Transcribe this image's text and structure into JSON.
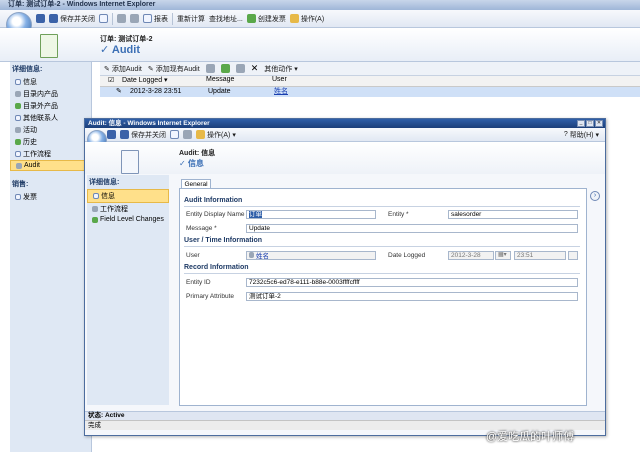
{
  "main_window": {
    "title": "订单: 测试订单-2 - Windows Internet Explorer",
    "toolbar": [
      "保存并关闭",
      "|",
      "报表",
      "重新计算",
      "查找地址...",
      "创建发票",
      "操作(A)"
    ],
    "record_type": "订单: 测试订单-2",
    "record_title": "Audit"
  },
  "left_nav": {
    "header": "详细信息:",
    "items": [
      "信息",
      "目录内产品",
      "目录外产品",
      "其他联系人",
      "活动",
      "历史",
      "工作流程",
      "Audit"
    ],
    "selected": "Audit",
    "sales_header": "销售:",
    "sales_items": [
      "发票"
    ]
  },
  "grid": {
    "toolbar": [
      "添加Audit",
      "添加现有Audit",
      "其他动作"
    ],
    "columns": [
      "Date Logged",
      "Message",
      "User"
    ],
    "rows": [
      {
        "date": "2012-3-28 23:51",
        "message": "Update",
        "user": "姓名"
      }
    ]
  },
  "popup": {
    "title": "Audit: 信息 - Windows Internet Explorer",
    "toolbar": [
      "保存并关闭",
      "操作(A)"
    ],
    "help": "帮助(H)",
    "record_type": "Audit: 信息",
    "record_title": "信息",
    "nav_header": "详细信息:",
    "nav_items": [
      "信息",
      "工作流程",
      "Field Level Changes"
    ],
    "nav_selected": "信息",
    "tab": "General",
    "sections": {
      "audit_info": "Audit Information",
      "user_time": "User / Time Information",
      "record_info": "Record Information"
    },
    "fields": {
      "entity_display_name_label": "Entity Display Name",
      "entity_display_name_value": "订单",
      "entity_label": "Entity *",
      "entity_value": "salesorder",
      "message_label": "Message *",
      "message_value": "Update",
      "user_label": "User",
      "user_value": "姓名",
      "date_logged_label": "Date Logged",
      "date_logged_date": "2012-3-28",
      "date_logged_time": "23:51",
      "entity_id_label": "Entity ID",
      "entity_id_value": "7232c5c6-ed78-e111-b88e-0003ffffcffff",
      "primary_attribute_label": "Primary Attribute",
      "primary_attribute_value": "测试订单-2"
    },
    "status": "状态: Active",
    "ie_status": "完成"
  },
  "watermark": "@爱吃瓜的叶师傅"
}
